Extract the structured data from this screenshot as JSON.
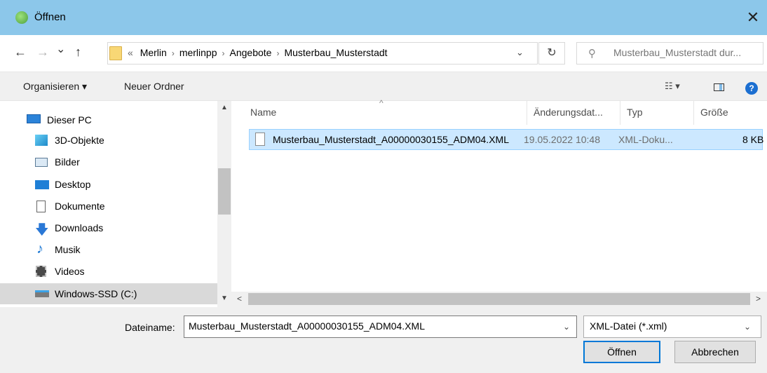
{
  "window": {
    "title": "Öffnen",
    "close_label": "✕"
  },
  "nav": {
    "back": "←",
    "forward": "→",
    "recent": "⌄",
    "up": "↑",
    "breadcrumb_prefix": "«",
    "breadcrumb": [
      "Merlin",
      "merlinpp",
      "Angebote",
      "Musterbau_Musterstadt"
    ],
    "search_placeholder": "Musterbau_Musterstadt dur..."
  },
  "toolbar": {
    "organize": "Organisieren ▾",
    "new_folder": "Neuer Ordner",
    "view_label": "☷ ▾",
    "help": "?"
  },
  "sidebar": {
    "items": [
      {
        "label": "Dieser PC",
        "icon": "monitor-icon"
      },
      {
        "label": "3D-Objekte",
        "icon": "cube-icon"
      },
      {
        "label": "Bilder",
        "icon": "image-icon"
      },
      {
        "label": "Desktop",
        "icon": "desktop-icon"
      },
      {
        "label": "Dokumente",
        "icon": "document-icon"
      },
      {
        "label": "Downloads",
        "icon": "download-arrow-icon"
      },
      {
        "label": "Musik",
        "icon": "music-note-icon"
      },
      {
        "label": "Videos",
        "icon": "film-icon"
      },
      {
        "label": "Windows-SSD (C:)",
        "icon": "drive-icon",
        "selected": true
      }
    ]
  },
  "filelist": {
    "columns": [
      "Name",
      "Änderungsdat...",
      "Typ",
      "Größe"
    ],
    "rows": [
      {
        "name": "Musterbau_Musterstadt_A00000030155_ADM04.XML",
        "modified": "19.05.2022 10:48",
        "type": "XML-Doku...",
        "size": "8 KB"
      }
    ]
  },
  "footer": {
    "filename_label": "Dateiname:",
    "filename_value": "Musterbau_Musterstadt_A00000030155_ADM04.XML",
    "filetype_value": "XML-Datei (*.xml)",
    "open_button": "Öffnen",
    "cancel_button": "Abbrechen"
  },
  "colors": {
    "titlebar": "#8cc7ea",
    "selection": "#cce8ff",
    "accent": "#0078d7"
  }
}
